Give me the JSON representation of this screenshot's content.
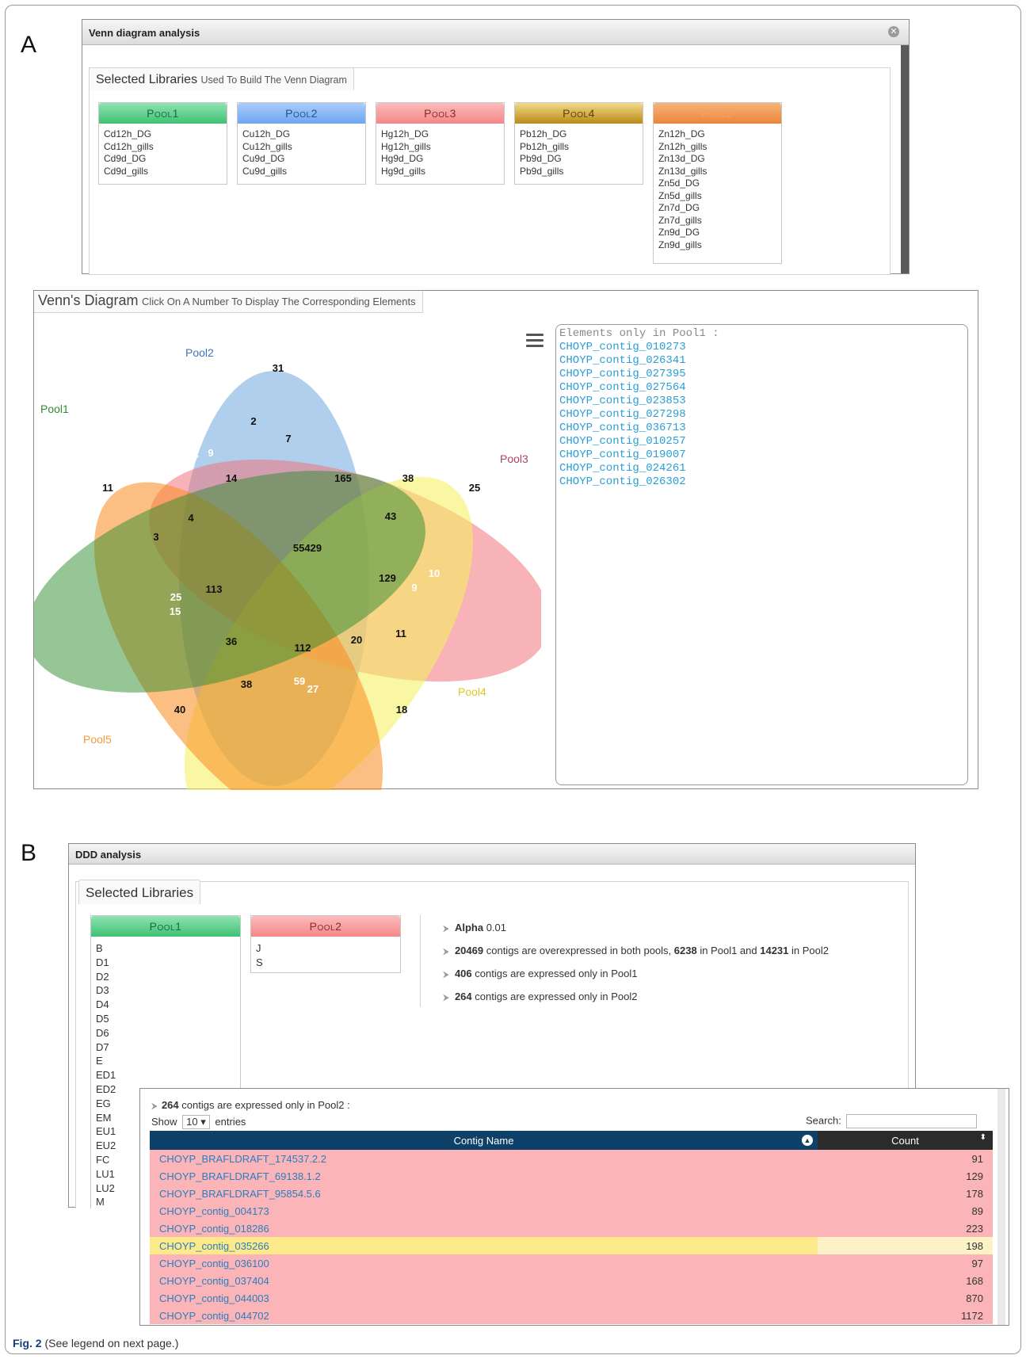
{
  "panel_a_letter": "A",
  "panel_b_letter": "B",
  "venn_window": {
    "title": "Venn diagram analysis",
    "close_icon": "close-icon",
    "section_title": "Selected Libraries",
    "section_subtitle": "Used To Build The Venn Diagram",
    "pools": [
      {
        "name": "Pool1",
        "color": "#4fcf82",
        "items": [
          "Cd12h_DG",
          "Cd12h_gills",
          "Cd9d_DG",
          "Cd9d_gills"
        ]
      },
      {
        "name": "Pool2",
        "color": "#7fb2f5",
        "items": [
          "Cu12h_DG",
          "Cu12h_gills",
          "Cu9d_DG",
          "Cu9d_gills"
        ]
      },
      {
        "name": "Pool3",
        "color": "#f79797",
        "items": [
          "Hg12h_DG",
          "Hg12h_gills",
          "Hg9d_DG",
          "Hg9d_gills"
        ]
      },
      {
        "name": "Pool4",
        "color": "#c9a02e",
        "items": [
          "Pb12h_DG",
          "Pb12h_gills",
          "Pb9d_DG",
          "Pb9d_gills"
        ]
      },
      {
        "name": "Pool5",
        "color": "#f0904a",
        "items": [
          "Zn12h_DG",
          "Zn12h_gills",
          "Zn13d_DG",
          "Zn13d_gills",
          "Zn5d_DG",
          "Zn5d_gills",
          "Zn7d_DG",
          "Zn7d_gills",
          "Zn9d_DG",
          "Zn9d_gills"
        ]
      }
    ]
  },
  "venn_panel": {
    "title": "Venn's Diagram",
    "subtitle": "Click On A Number To Display The Corresponding Elements",
    "menu_icon": "hamburger-menu-icon",
    "set_labels": {
      "pool1": "Pool1",
      "pool2": "Pool2",
      "pool3": "Pool3",
      "pool4": "Pool4",
      "pool5": "Pool5"
    },
    "set_colors": {
      "pool1": "#2e8b2e",
      "pool2": "#5a9bd6",
      "pool3": "#f08080",
      "pool4": "#f6ee6a",
      "pool5": "#f79a3e"
    },
    "region_counts": [
      "31",
      "2",
      "4",
      "9",
      "7",
      "4",
      "25",
      "11",
      "14",
      "165",
      "38",
      "25",
      "4",
      "43",
      "3",
      "55429",
      "129",
      "10",
      "9",
      "25",
      "15",
      "113",
      "36",
      "112",
      "20",
      "11",
      "38",
      "59",
      "27",
      "40",
      "18"
    ],
    "elements_header": "Elements only in Pool1 :",
    "elements": [
      "CHOYP_contig_010273",
      "CHOYP_contig_026341",
      "CHOYP_contig_027395",
      "CHOYP_contig_027564",
      "CHOYP_contig_023853",
      "CHOYP_contig_027298",
      "CHOYP_contig_036713",
      "CHOYP_contig_010257",
      "CHOYP_contig_019007",
      "CHOYP_contig_024261",
      "CHOYP_contig_026302"
    ]
  },
  "ddd_window": {
    "title": "DDD analysis",
    "section_title": "Selected Libraries",
    "pool1": {
      "name": "Pool1",
      "color": "#4fcf82",
      "items": [
        "B",
        "D1",
        "D2",
        "D3",
        "D4",
        "D5",
        "D6",
        "D7",
        "E",
        "ED1",
        "ED2",
        "EG",
        "EM",
        "EU1",
        "EU2",
        "FC",
        "LU1",
        "LU2",
        "M"
      ]
    },
    "pool2": {
      "name": "Pool2",
      "color": "#f79797",
      "items": [
        "J",
        "S"
      ]
    },
    "stats": {
      "alpha_label": "Alpha",
      "alpha_value": "0.01",
      "both_count": "20469",
      "both_text": "contigs are overexpressed in both pools,",
      "both_pool1_count": "6238",
      "both_pool1_text": "in Pool1 and",
      "both_pool2_count": "14231",
      "both_pool2_text": "in Pool2",
      "only1_count": "406",
      "only1_text": "contigs are expressed only in Pool1",
      "only2_count": "264",
      "only2_text": "contigs are expressed only in Pool2"
    }
  },
  "table_overlay": {
    "caption_count": "264",
    "caption_text": "contigs are expressed only in Pool2 :",
    "show_label": "Show",
    "show_value": "10",
    "entries_label": "entries",
    "search_label": "Search:",
    "columns": [
      "Contig Name",
      "Count"
    ],
    "rows": [
      {
        "name": "CHOYP_BRAFLDRAFT_174537.2.2",
        "count": "91"
      },
      {
        "name": "CHOYP_BRAFLDRAFT_69138.1.2",
        "count": "129"
      },
      {
        "name": "CHOYP_BRAFLDRAFT_95854.5.6",
        "count": "178"
      },
      {
        "name": "CHOYP_contig_004173",
        "count": "89"
      },
      {
        "name": "CHOYP_contig_018286",
        "count": "223"
      },
      {
        "name": "CHOYP_contig_035266",
        "count": "198",
        "highlighted": true
      },
      {
        "name": "CHOYP_contig_036100",
        "count": "97"
      },
      {
        "name": "CHOYP_contig_037404",
        "count": "168"
      },
      {
        "name": "CHOYP_contig_044003",
        "count": "870"
      },
      {
        "name": "CHOYP_contig_044702",
        "count": "1172"
      }
    ]
  },
  "caption": {
    "label": "Fig. 2",
    "text": "(See legend on next page.)"
  }
}
